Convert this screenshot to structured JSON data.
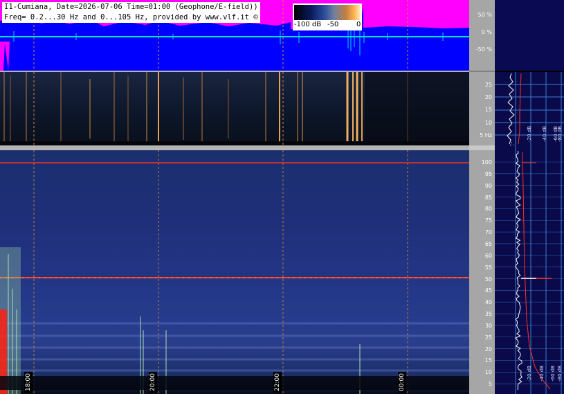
{
  "header": {
    "line1": "I1-Cumiana, Date=2026-07-06 Time=01:00 (Geophone/E-field))",
    "line2": "Freq= 0.2...30 Hz and 0...105 Hz, provided by www.vlf.it ©"
  },
  "colorbar": {
    "labels": [
      "-100 dB",
      "-50",
      "0"
    ]
  },
  "waveform_axis": {
    "ticks": [
      "50 %",
      "0 %",
      "-50 %"
    ]
  },
  "hires_axis": {
    "ticks": [
      "25",
      "20",
      "15",
      "10",
      "5 Hz"
    ]
  },
  "main_axis": {
    "ticks": [
      "100",
      "95",
      "90",
      "85",
      "80",
      "75",
      "70",
      "65",
      "60",
      "55",
      "50",
      "45",
      "40",
      "35",
      "30",
      "25",
      "20",
      "15",
      "10",
      "5"
    ]
  },
  "profile_axis_upper": {
    "labels": [
      "-20 dB",
      "-40 dB",
      "-60 dB",
      "-80 dB"
    ]
  },
  "profile_axis_lower": {
    "labels": [
      "-20 dB",
      "-40 dB",
      "-60 dB",
      "-80 dB"
    ]
  },
  "time_labels": [
    "18:00",
    "20:00",
    "22:00",
    "00:00"
  ],
  "colors": {
    "waveform_bg": "#0000ff",
    "waveform_fill": "#ff00ff",
    "zero_line": "#00e0e0",
    "grid_dashed": "#d88a3a",
    "mains_line": "#ff3020",
    "profile_bg": "#0a0a4a",
    "profile_grid": "#3a7fd0"
  }
}
